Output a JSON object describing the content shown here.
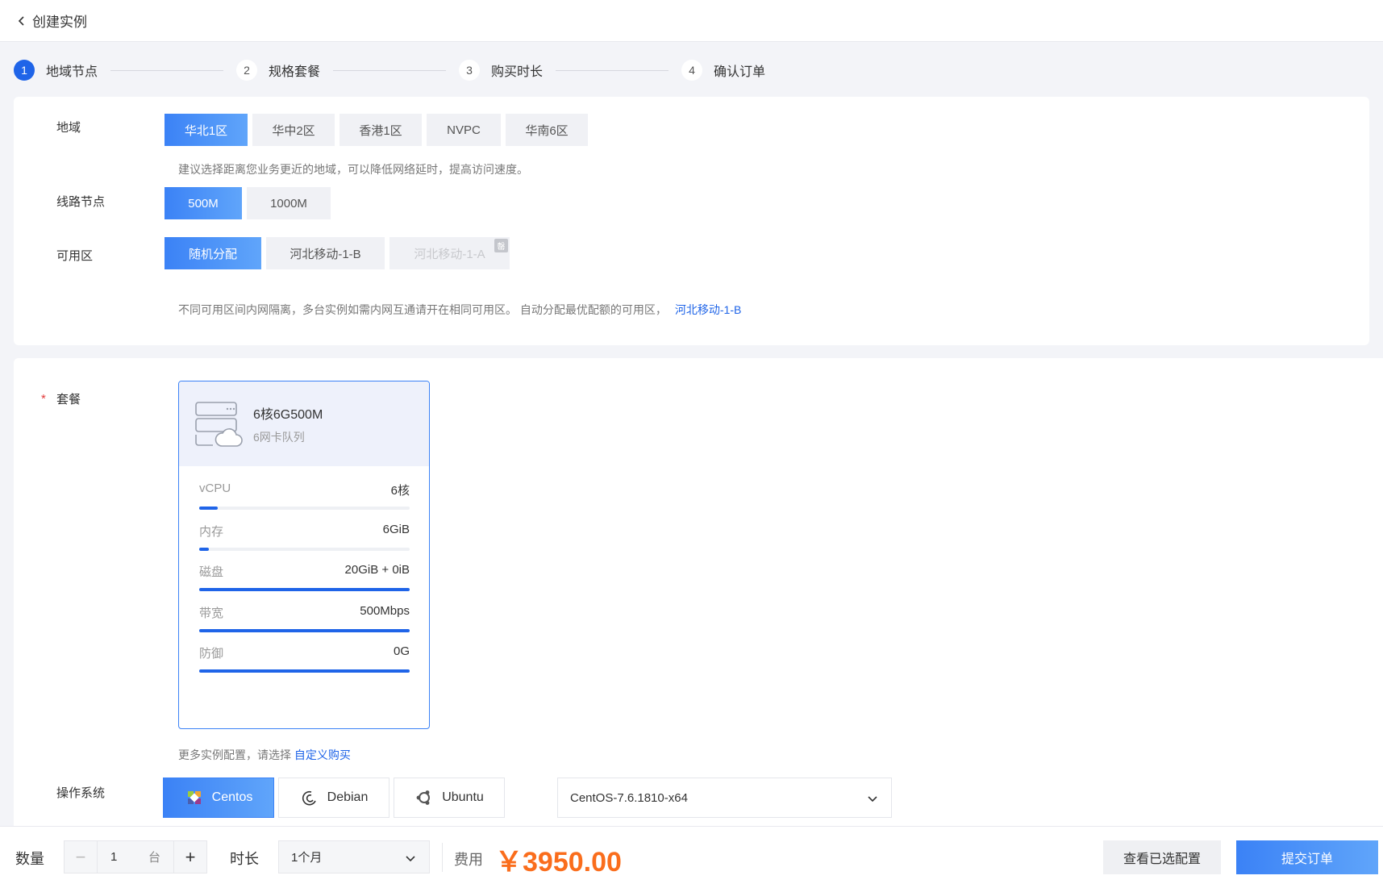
{
  "header": {
    "title": "创建实例"
  },
  "steps": [
    {
      "num": "1",
      "label": "地域节点"
    },
    {
      "num": "2",
      "label": "规格套餐"
    },
    {
      "num": "3",
      "label": "购买时长"
    },
    {
      "num": "4",
      "label": "确认订单"
    }
  ],
  "region": {
    "label": "地域",
    "options": [
      "华北1区",
      "华中2区",
      "香港1区",
      "NVPC",
      "华南6区"
    ],
    "selected": "华北1区",
    "hint": "建议选择距离您业务更近的地域，可以降低网络延时，提高访问速度。"
  },
  "line": {
    "label": "线路节点",
    "options": [
      "500M",
      "1000M"
    ],
    "selected": "500M"
  },
  "zone": {
    "label": "可用区",
    "options": [
      "随机分配",
      "河北移动-1-B",
      "河北移动-1-A"
    ],
    "selected": "随机分配",
    "disabled_badge": "罄",
    "hint": "不同可用区间内网隔离，多台实例如需内网互通请开在相同可用区。 自动分配最优配额的可用区，",
    "hint_link": "河北移动-1-B"
  },
  "package": {
    "required_mark": "*",
    "label": "套餐",
    "name": "6核6G500M",
    "sub": "6网卡队列",
    "specs": [
      {
        "name": "vCPU",
        "value": "6核",
        "fill": 0.09
      },
      {
        "name": "内存",
        "value": "6GiB",
        "fill": 0.045
      },
      {
        "name": "磁盘",
        "value": "20GiB + 0iB",
        "fill": 1.0
      },
      {
        "name": "带宽",
        "value": "500Mbps",
        "fill": 1.0
      },
      {
        "name": "防御",
        "value": "0G",
        "fill": 1.0
      }
    ],
    "more_hint": "更多实例配置，请选择",
    "more_link": "自定义购买"
  },
  "os": {
    "label": "操作系统",
    "options": [
      "Centos",
      "Debian",
      "Ubuntu"
    ],
    "selected": "Centos",
    "version": "CentOS-7.6.1810-x64"
  },
  "bottom": {
    "qty_label": "数量",
    "qty_minus": "−",
    "qty_value": "1",
    "qty_unit": "台",
    "qty_plus": "+",
    "dur_label": "时长",
    "dur_value": "1个月",
    "fee_label": "费用",
    "fee_value": "￥3950.00",
    "view_btn": "查看已选配置",
    "submit_btn": "提交订单"
  },
  "colors": {
    "accent": "#1f64e8",
    "price": "#fa6d1c",
    "selected_start": "#3b82f6",
    "selected_end": "#60a5fa"
  }
}
